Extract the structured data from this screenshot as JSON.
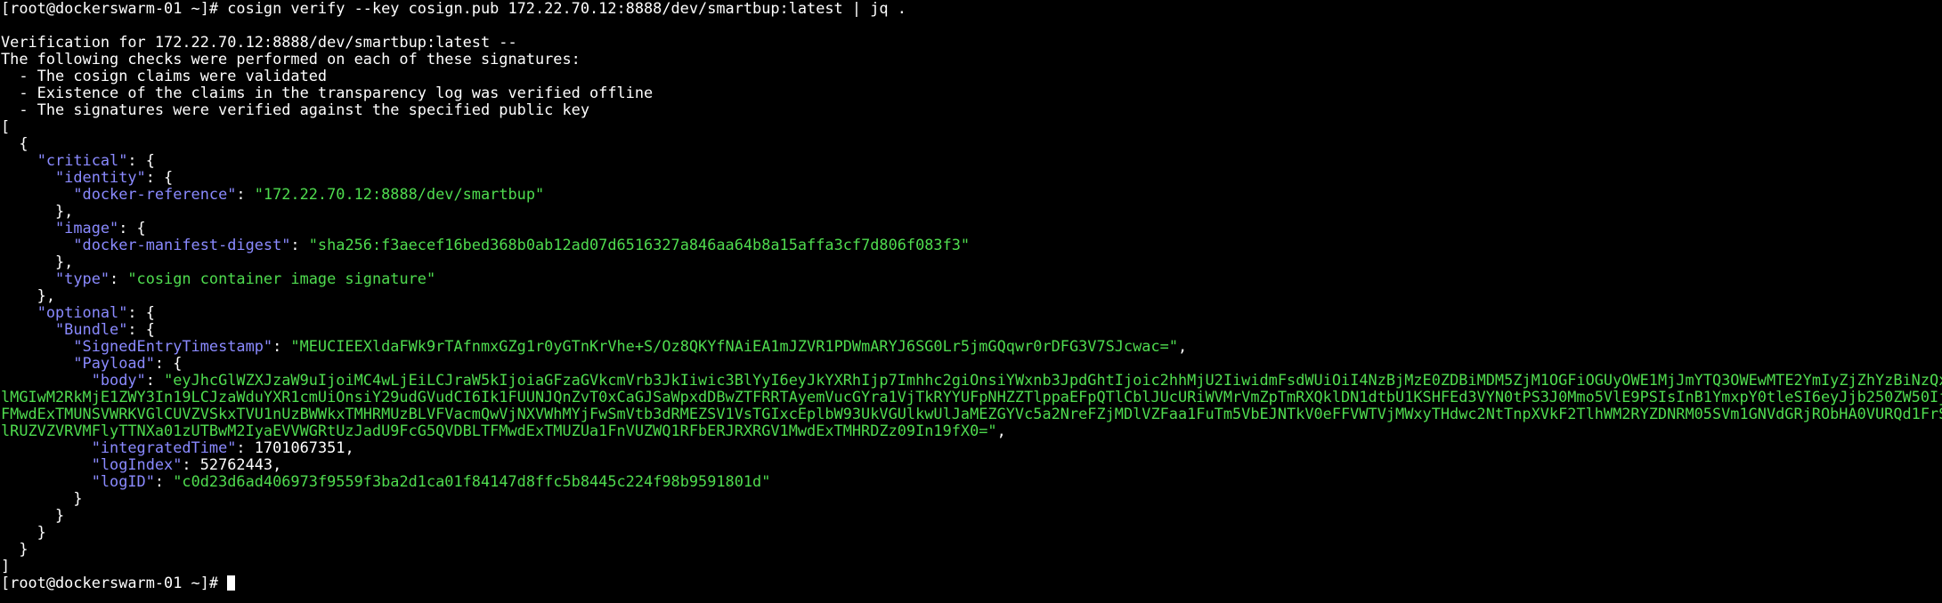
{
  "terminal": {
    "prompt": "[root@dockerswarm-01 ~]# ",
    "command": "cosign verify --key cosign.pub 172.22.70.12:8888/dev/smartbup:latest | jq .",
    "verification_header": "Verification for 172.22.70.12:8888/dev/smartbup:latest --",
    "checks_intro": "The following checks were performed on each of these signatures:",
    "checks": [
      "  - The cosign claims were validated",
      "  - Existence of the claims in the transparency log was verified offline",
      "  - The signatures were verified against the specified public key"
    ],
    "json": {
      "critical_key": "\"critical\"",
      "identity_key": "\"identity\"",
      "docker_reference_key": "\"docker-reference\"",
      "docker_reference_value": "\"172.22.70.12:8888/dev/smartbup\"",
      "image_key": "\"image\"",
      "docker_manifest_digest_key": "\"docker-manifest-digest\"",
      "docker_manifest_digest_value": "\"sha256:f3aecef16bed368b0ab12ad07d6516327a846aa64b8a15affa3cf7d806f083f3\"",
      "type_key": "\"type\"",
      "type_value": "\"cosign container image signature\"",
      "optional_key": "\"optional\"",
      "bundle_key": "\"Bundle\"",
      "signed_entry_timestamp_key": "\"SignedEntryTimestamp\"",
      "signed_entry_timestamp_value": "\"MEUCIEEXldaFWk9rTAfnmxGZg1r0yGTnKrVhe+S/Oz8QKYfNAiEA1mJZVR1PDWmARYJ6SG0Lr5jmGQqwr0rDFG3V7SJcwac=\"",
      "payload_key": "\"Payload\"",
      "body_key": "\"body\"",
      "body_value_line1": "\"eyJhcGlWZXJzaW9uIjoiMC4wLjEiLCJraW5kIjoiaGFzaGVkcmVrb3JkIiwic3BlYyI6eyJkYXRhIjp7Imhhc2giOnsiYWxnb3JpdGhtIjoic2hhMjU2IiwidmFsdWUiOiI4NzBjMzE0ZDBiMDM5ZjM1OGFiOGUyOWE1MjJmYTQ3OWEwMTE2YmIyZjZhYzBiNzQxMjB",
      "body_value_line2": "lMGIwM2RkMjE1ZWY3In19LCJzaWduYXR1cmUiOnsiY29udGVudCI6Ik1FUUNJQnZvT0xCaGJSaWpxdDBwZTFRRTAyemVucGYra1VjTkRYYUFpNHZZTlppaEFpQTlCblJUcURiWVMrVmZpTmRXQklDN1dtbU1KSHFEd3VYN0tPS3J0Mmo5VlE9PSIsInB1YmxpY0tleSI6eyJjb250ZW50IjoiT",
      "body_value_line3": "FMwdExTMUNSVWRKVGlCUVZVSkxTVU1nUzBWWkxTMHRMUzBLVFVacmQwVjNXVWhMYjFwSmVtb3dRMEZSV1VsTGIxcEplbW93UkVGUlkwUlJaMEZGYVc5a2NreFZjMDlVZFaa1FuTm5VbEJNTkV0eFFVWTVjMWxyTHdwc2NtTnpXVkF2TlhWM2RYZDNRM05SVm1GNVdGRjRObHA0VURQd1FrSXJ",
      "body_value_line4": "lRUZVZVRVMFlyTTNXa01zUTBwM2IyaEVVWGRtUzJadU9FcG5QVDBLTFMwdExTMUZUa1FnVUZWQ1RFbERJRXRGV1MwdExTMHRDZz09In19fX0=\"",
      "integrated_time_key": "\"integratedTime\"",
      "integrated_time_value": "1701067351",
      "log_index_key": "\"logIndex\"",
      "log_index_value": "52762443",
      "log_id_key": "\"logID\"",
      "log_id_value": "\"c0d23d6ad406973f9559f3ba2d1ca01f84147d8ffc5b8445c224f98b9591801d\""
    }
  },
  "colors": {
    "background": "#000000",
    "text": "#ffffff",
    "json_key": "#8a8aff",
    "json_string": "#4fdc4f"
  }
}
